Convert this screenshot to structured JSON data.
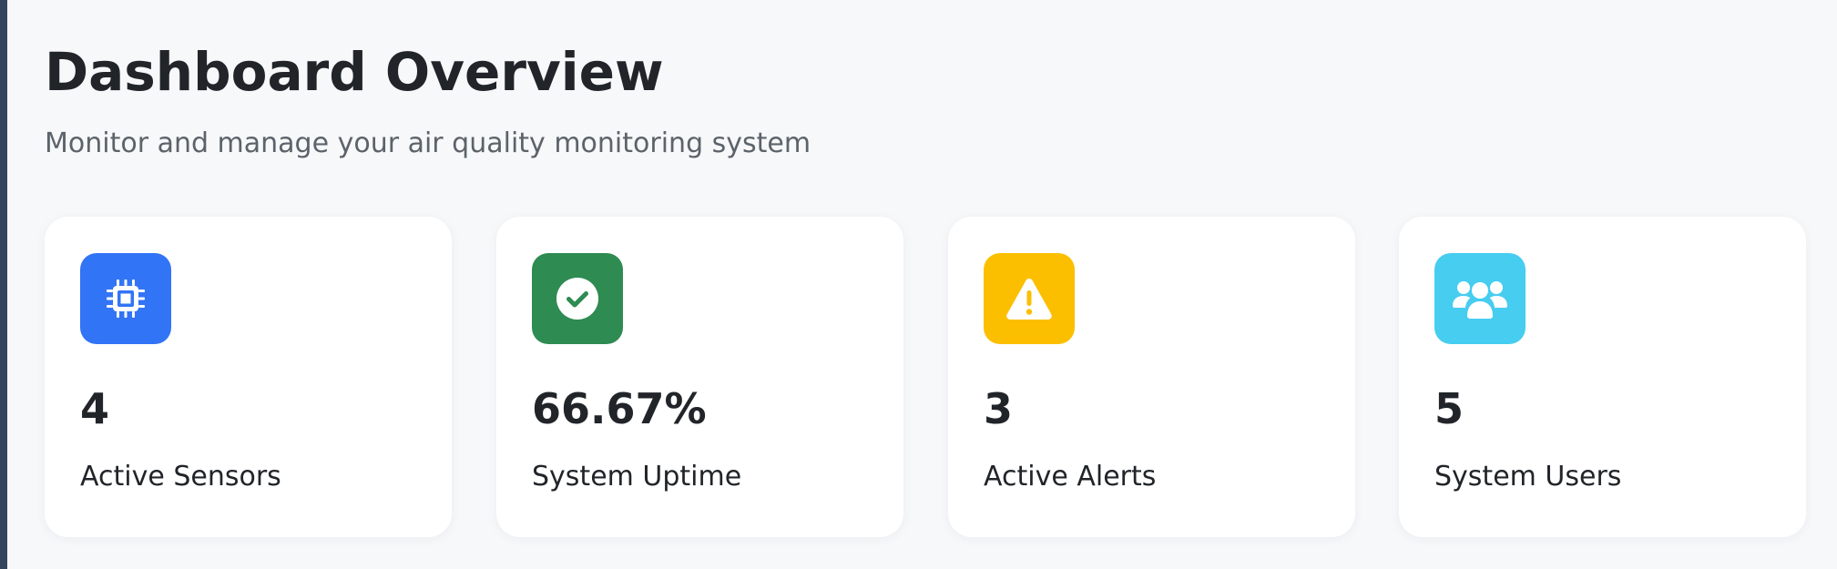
{
  "header": {
    "title": "Dashboard Overview",
    "subtitle": "Monitor and manage your air quality monitoring system"
  },
  "stats": [
    {
      "icon": "cpu-chip-icon",
      "color": "#3274f6",
      "value": "4",
      "label": "Active Sensors"
    },
    {
      "icon": "check-circle-icon",
      "color": "#2e8b52",
      "value": "66.67%",
      "label": "System Uptime"
    },
    {
      "icon": "warning-triangle-icon",
      "color": "#fcbf00",
      "value": "3",
      "label": "Active Alerts"
    },
    {
      "icon": "users-icon",
      "color": "#46cdf0",
      "value": "5",
      "label": "System Users"
    }
  ]
}
